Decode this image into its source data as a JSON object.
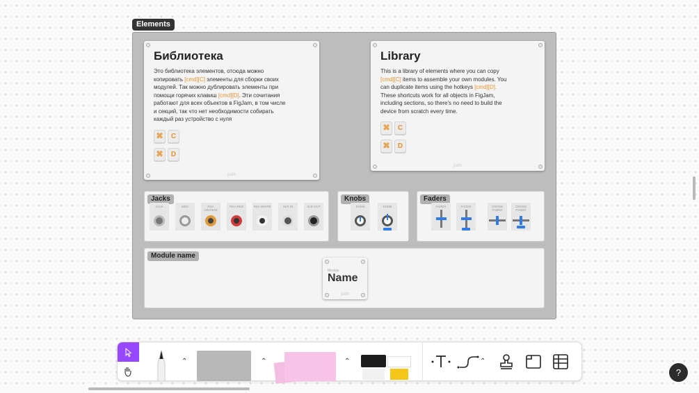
{
  "frame": {
    "label": "Elements"
  },
  "ru_card": {
    "title": "Библиотека",
    "line1": "Это библиотека элементов, отсюда можно",
    "line2_pre": "копировать ",
    "line2_hl": "[cmd][C]",
    "line2_post": " элементы для сборки своих",
    "line3": "модулей. Так можно дублировать элементы при",
    "line4_pre": "помощи горячих клавиш ",
    "line4_hl": "[cmd][D]",
    "line4_post": ". Эти сочитания",
    "line5": "работают для всех объектов в FigJam, в том числе",
    "line6": "и секций, так что нет необходимости собирать",
    "line7": "каждый раз устройство с нуля",
    "key_cmd": "⌘",
    "key_c": "C",
    "key_d": "D",
    "ghost": "path"
  },
  "en_card": {
    "title": "Library",
    "line1": "This is a library of elements where you can copy",
    "line2_hl": "[cmd][C]",
    "line2_post": " items to assemble your own modules. You",
    "line3_pre": "can duplicate items using the hotkeys ",
    "line3_hl": "[cmd][D].",
    "line4": "These shortcuts work for all objects in FigJam,",
    "line5": "including sections, so there's no need to build the",
    "line6": "device from scratch every time.",
    "key_cmd": "⌘",
    "key_c": "C",
    "key_d": "D",
    "ghost": "path"
  },
  "jacks": {
    "title": "Jacks",
    "items": [
      "JACK",
      "MIDI",
      "RSA ORANGE",
      "RSA RED",
      "RSA WHITE",
      "XLR IN",
      "XLR OUT"
    ]
  },
  "knobs": {
    "title": "Knobs",
    "items": [
      "KNOB",
      "KNOB"
    ]
  },
  "faders": {
    "title": "Faders",
    "items": [
      "FADER",
      "FADER",
      "CROSS FADER",
      "CROSS FADER"
    ]
  },
  "module": {
    "title": "Module name",
    "small": "Module",
    "name": "Name",
    "ghost": "path"
  },
  "help": {
    "label": "?"
  },
  "colors": {
    "accent": "#e8922e",
    "toolbar_select": "#9747ff",
    "sticky": "#f7c3e6"
  }
}
